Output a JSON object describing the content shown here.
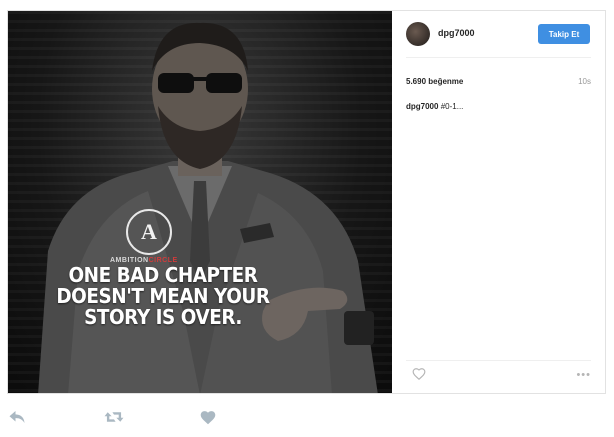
{
  "post": {
    "quote_lines": [
      "ONE BAD CHAPTER",
      "DOESN'T MEAN YOUR",
      "STORY IS OVER."
    ],
    "logo_letter": "A",
    "brand_text": "AMBITION",
    "brand_text_highlight": "CIRCLE"
  },
  "sidebar": {
    "username": "dpg7000",
    "follow_label": "Takip Et",
    "likes": "5.690 beğenme",
    "time": "10s",
    "caption_user": "dpg7000",
    "caption_text": "#0-1...",
    "more": "•••"
  },
  "colors": {
    "follow_button": "#3f8fe2",
    "action_icons": "#aab8c2"
  },
  "icons": {
    "heart": "heart-icon",
    "reply": "reply-icon",
    "retweet": "retweet-icon",
    "like": "like-heart-icon"
  }
}
